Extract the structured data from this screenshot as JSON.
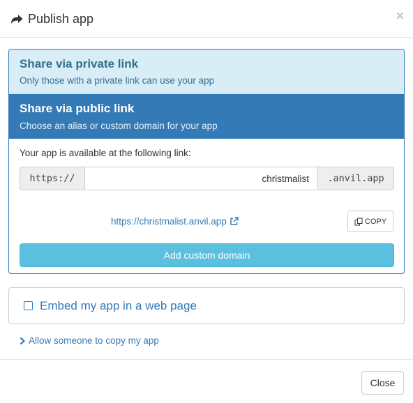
{
  "header": {
    "title": "Publish app",
    "icon": "share-arrow-icon",
    "close_glyph": "×"
  },
  "private_link": {
    "title": "Share via private link",
    "subtitle": "Only those with a private link can use your app"
  },
  "public_link": {
    "title": "Share via public link",
    "subtitle": "Choose an alias or custom domain for your app",
    "available_label": "Your app is available at the following link:",
    "prefix": "https://",
    "alias_value": "christmalist",
    "suffix": ".anvil.app",
    "url": "https://christmalist.anvil.app",
    "copy_label": "COPY",
    "custom_domain_label": "Add custom domain"
  },
  "embed": {
    "label": "Embed my app in a web page",
    "checked": false
  },
  "allow_copy": {
    "label": "Allow someone to copy my app"
  },
  "footer": {
    "close_label": "Close"
  },
  "colors": {
    "primary": "#337ab7",
    "info_bg": "#d9edf7",
    "info_text": "#31708f",
    "info_button": "#5bc0de"
  }
}
